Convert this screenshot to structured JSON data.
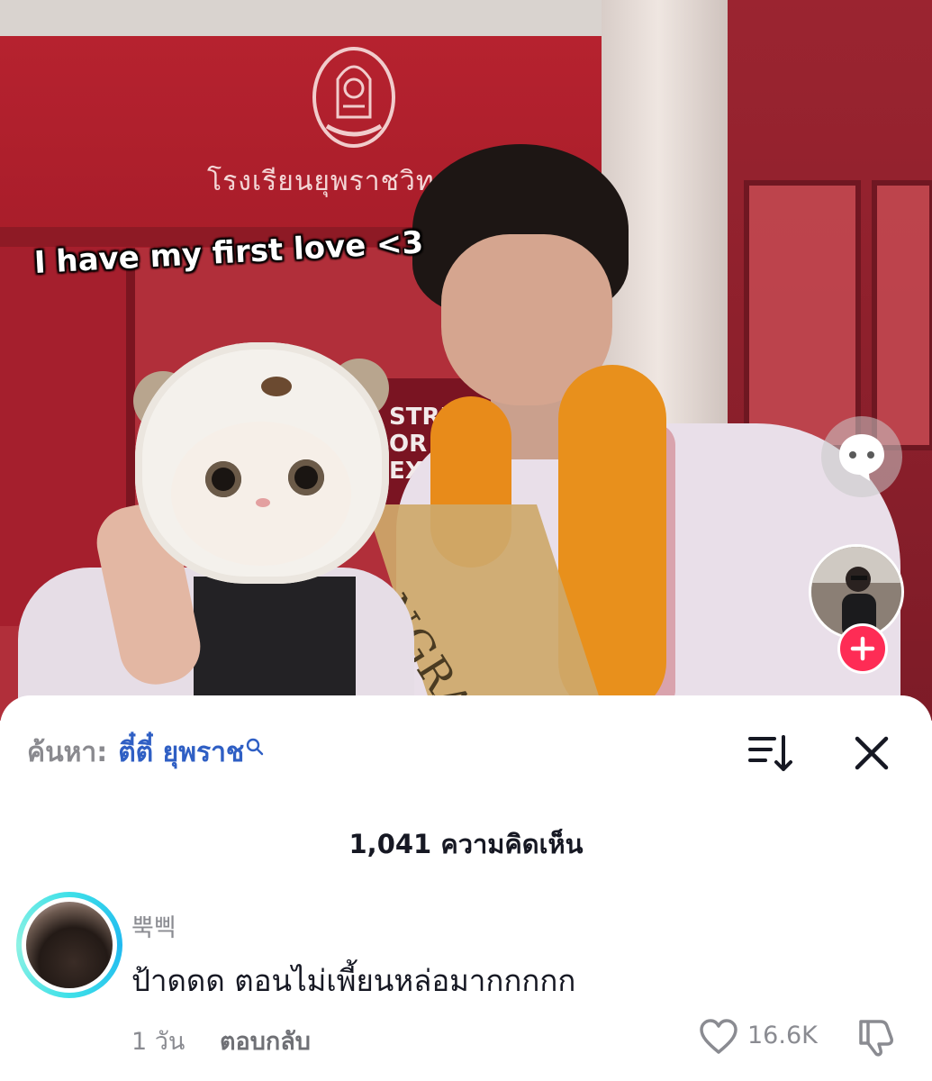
{
  "video": {
    "overlay_caption": "I have my first love <3",
    "school_sign": "โรงเรียนยุพราชวิทยาลัย",
    "banner_text": "STRIVE\nOR YO\nEXC",
    "sash_text": "NGRAT"
  },
  "sheet": {
    "search_prefix": "ค้นหา:",
    "search_term": "ตี๋ตี๋ ยุพราช",
    "comment_count_label": "1,041 ความคิดเห็น"
  },
  "comments": [
    {
      "username": "뿍삑",
      "text": "ป้าดดด ตอนไม่เพี้ยนหล่อมากกกกก",
      "time": "1 วัน",
      "reply_label": "ตอบกลับ",
      "likes": "16.6K"
    }
  ],
  "icons": {
    "comment_button": "chat-bubble-icon",
    "follow": "plus-icon",
    "sort": "sort-icon",
    "close": "close-icon",
    "like": "heart-icon",
    "dislike": "thumbs-down-icon",
    "search": "search-icon"
  },
  "colors": {
    "accent_link": "#2f5fc4",
    "follow_red": "#fe2c55",
    "story_ring": "#3ee0e8"
  }
}
